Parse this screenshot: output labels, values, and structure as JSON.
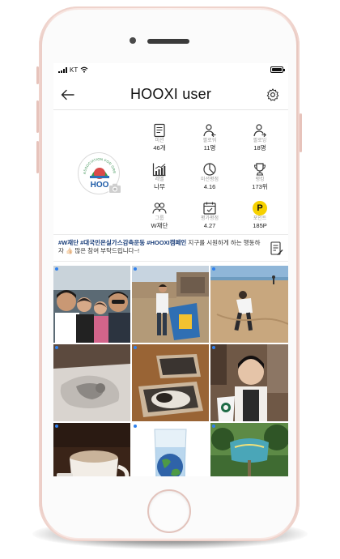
{
  "status": {
    "carrier": "KT"
  },
  "header": {
    "title": "HOOXI user"
  },
  "avatar": {
    "logo_text": "HOO",
    "ring_text": "ASSOCIATION FOR GREEN EARTH"
  },
  "stats": [
    {
      "icon": "list-icon",
      "label": "미션",
      "value": "46개"
    },
    {
      "icon": "follower-icon",
      "label": "팔로워",
      "value": "11명"
    },
    {
      "icon": "following-icon",
      "label": "팔로잉",
      "value": "18명"
    },
    {
      "icon": "level-chart-icon",
      "label": "레벨",
      "value": "나무"
    },
    {
      "icon": "pie-chart-icon",
      "label": "미션평점",
      "value": "4.16"
    },
    {
      "icon": "trophy-icon",
      "label": "랭킹",
      "value": "173위"
    },
    {
      "icon": "group-icon",
      "label": "그룹",
      "value": "W재단"
    },
    {
      "icon": "calendar-icon",
      "label": "평가평점",
      "value": "4.27"
    },
    {
      "icon": "point-coin-icon",
      "label": "포인트",
      "value": "185P",
      "coin": "P"
    }
  ],
  "bio": {
    "tags": "#W재단 #대국민온실가스감축운동 #HOOXI캠페인",
    "text": " 지구를 시원하게 하는 행동하자 👍🏻 많은 참여 부탁드립니다~!"
  },
  "posts": [
    {
      "name": "selfie-group-photo"
    },
    {
      "name": "beach-recycling-bin-photo"
    },
    {
      "name": "beach-walk-photo"
    },
    {
      "name": "sleeping-cat-photo"
    },
    {
      "name": "cat-in-box-photo"
    },
    {
      "name": "starbucks-tumbler-photo"
    },
    {
      "name": "coffee-mug-photo"
    },
    {
      "name": "earth-in-glass-photo"
    },
    {
      "name": "eco-sign-garden-photo"
    }
  ],
  "colors": {
    "accent": "#2f80ed",
    "coin": "#f6d100",
    "hashtag": "#1a3e7a",
    "phone": "#f7e4df"
  }
}
